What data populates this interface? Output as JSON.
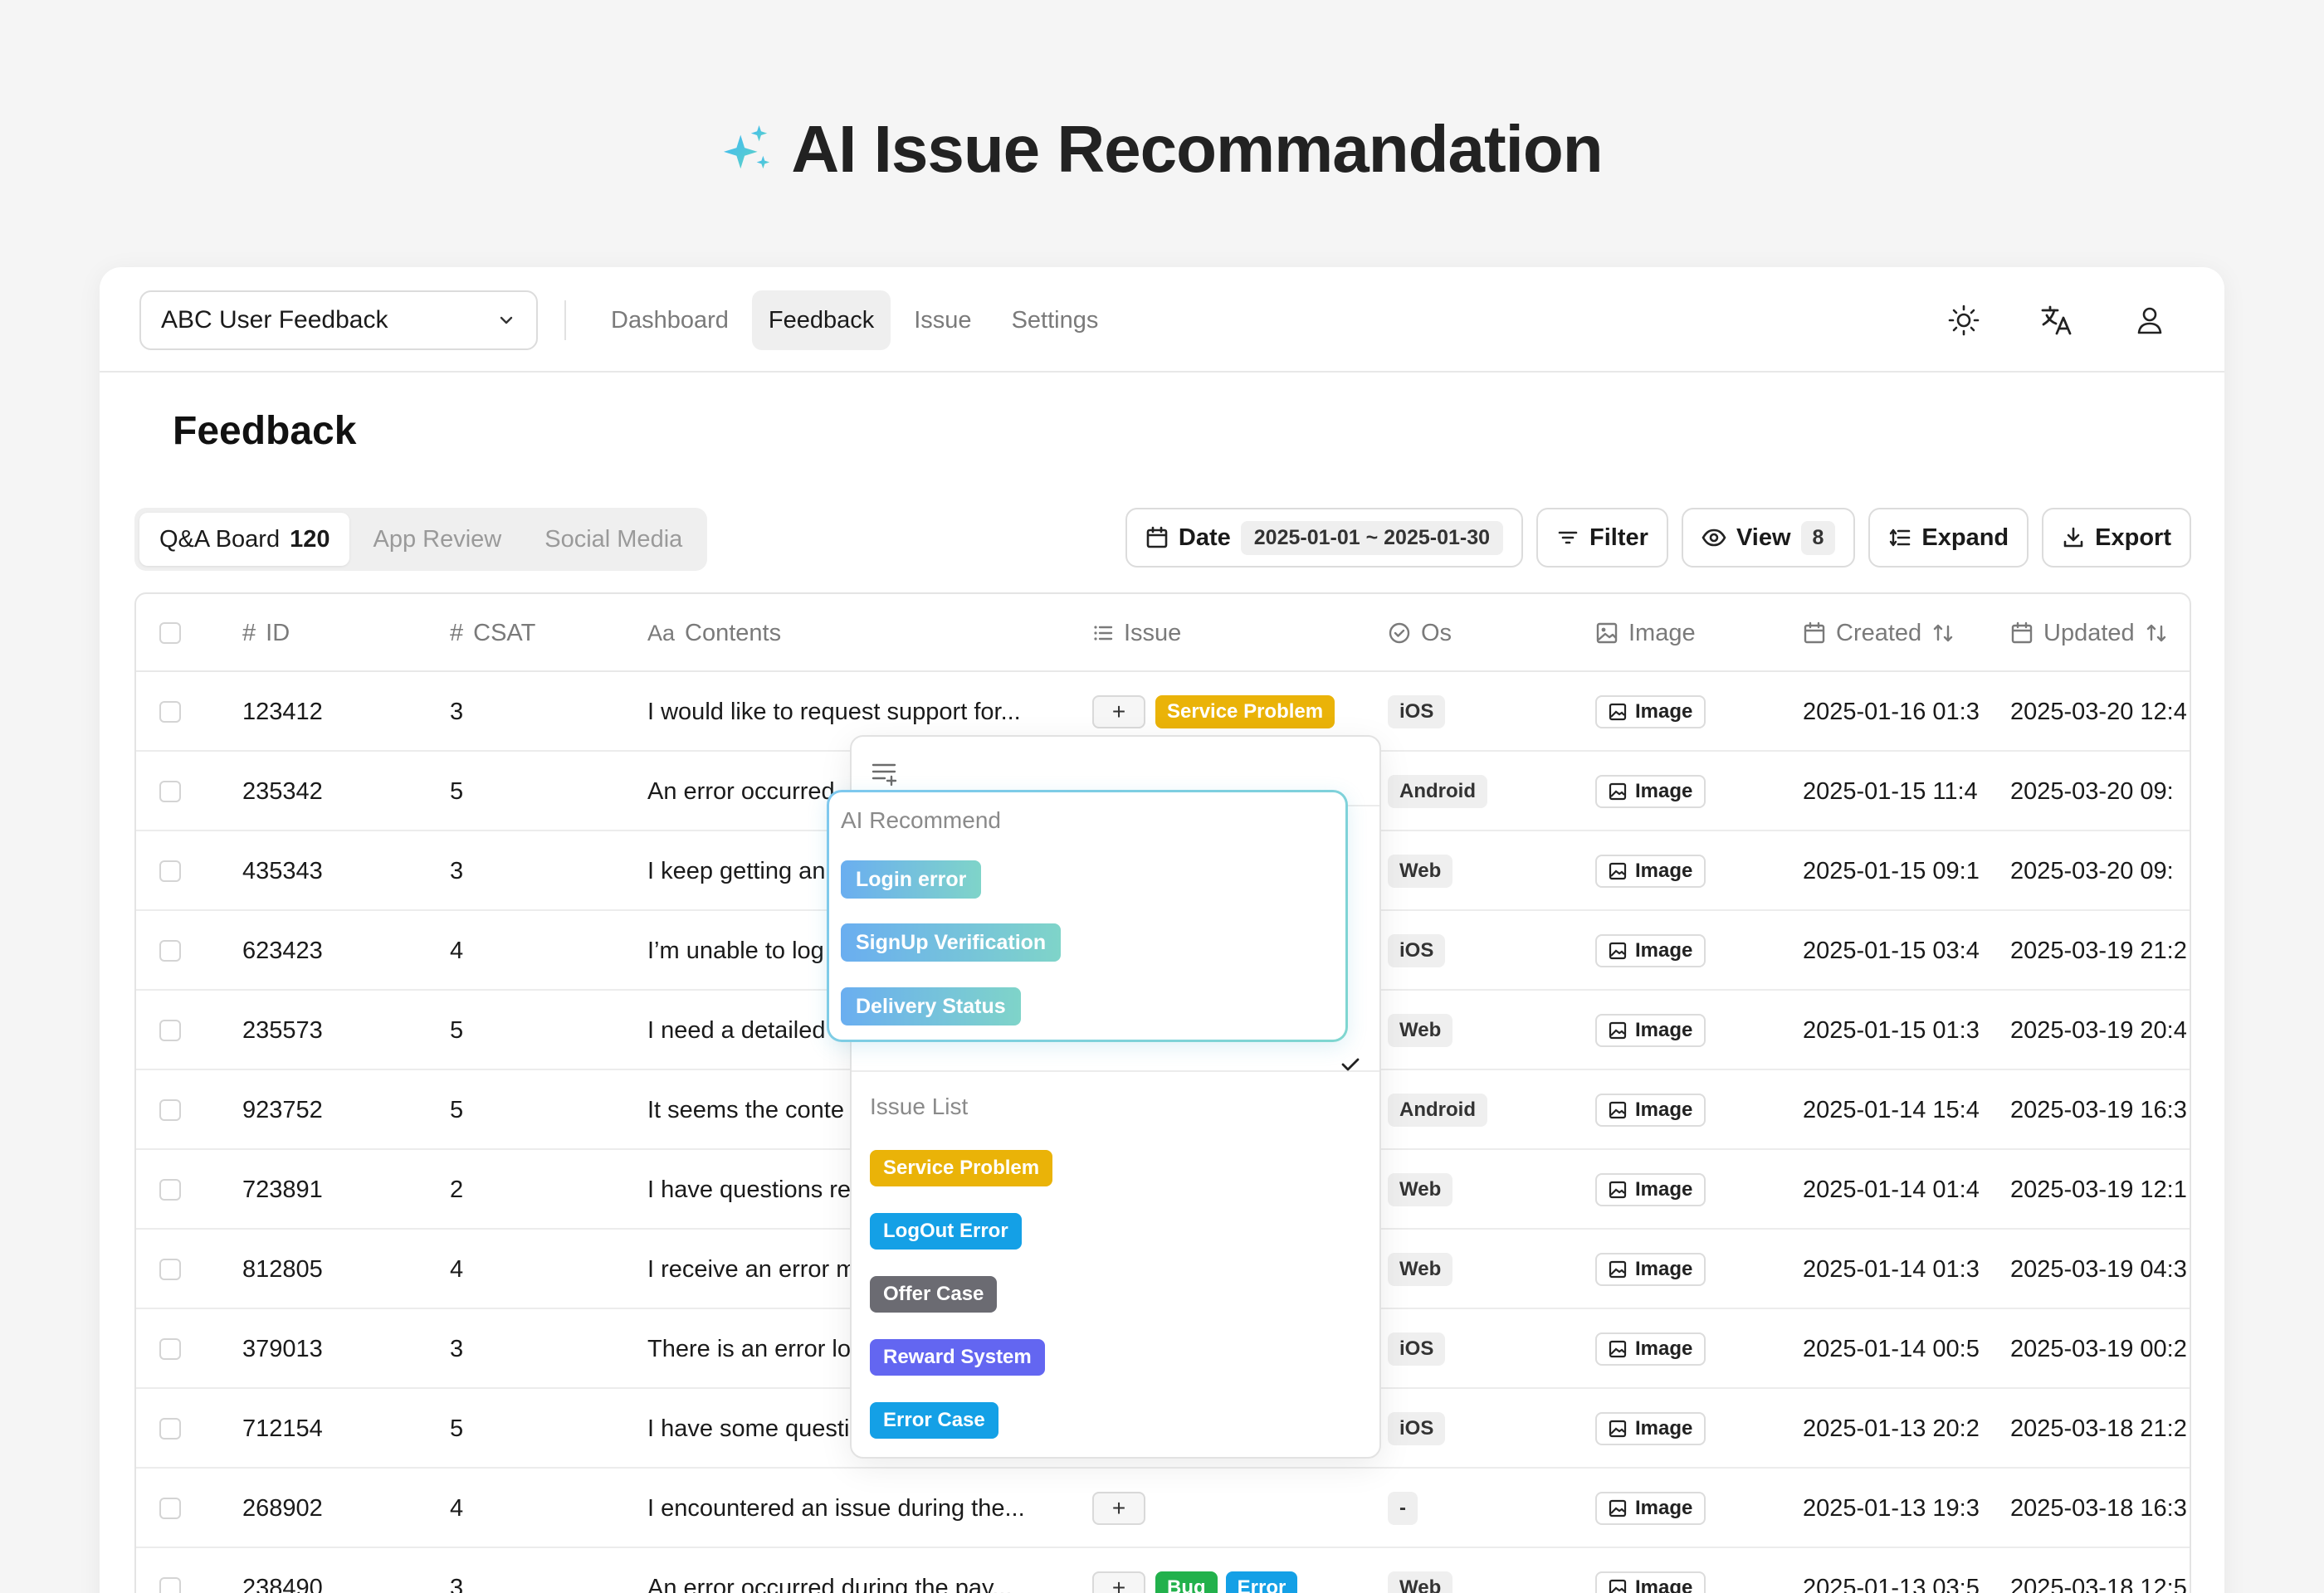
{
  "hero": {
    "title": "AI Issue Recommandation"
  },
  "header": {
    "project": "ABC User Feedback",
    "nav": [
      "Dashboard",
      "Feedback",
      "Issue",
      "Settings"
    ],
    "active_nav": "Feedback"
  },
  "page": {
    "title": "Feedback"
  },
  "channels": [
    {
      "label": "Q&A Board",
      "count": "120",
      "active": true
    },
    {
      "label": "App Review",
      "count": "",
      "active": false
    },
    {
      "label": "Social Media",
      "count": "",
      "active": false
    }
  ],
  "toolbar": {
    "date_label": "Date",
    "date_range": "2025-01-01 ~ 2025-01-30",
    "filter_label": "Filter",
    "view_label": "View",
    "view_count": "8",
    "expand_label": "Expand",
    "export_label": "Export"
  },
  "columns": {
    "id": "ID",
    "csat": "CSAT",
    "contents": "Contents",
    "issue": "Issue",
    "os": "Os",
    "image": "Image",
    "created": "Created",
    "updated": "Updated"
  },
  "rows": [
    {
      "id": "123412",
      "csat": "3",
      "contents": "I would like to request support for...",
      "issues": [
        "Service Problem"
      ],
      "os": "iOS",
      "image": "Image",
      "created": "2025-01-16 01:3",
      "updated": "2025-03-20 12:4"
    },
    {
      "id": "235342",
      "csat": "5",
      "contents": "An error occurred",
      "issues": [],
      "os": "Android",
      "image": "Image",
      "created": "2025-01-15 11:4",
      "updated": "2025-03-20 09:"
    },
    {
      "id": "435343",
      "csat": "3",
      "contents": "I keep getting an",
      "issues": [],
      "os": "Web",
      "image": "Image",
      "created": "2025-01-15 09:1",
      "updated": "2025-03-20 09:"
    },
    {
      "id": "623423",
      "csat": "4",
      "contents": "I’m unable to log",
      "issues": [],
      "os": "iOS",
      "image": "Image",
      "created": "2025-01-15 03:4",
      "updated": "2025-03-19 21:2"
    },
    {
      "id": "235573",
      "csat": "5",
      "contents": "I need a detailed",
      "issues": [],
      "os": "Web",
      "image": "Image",
      "created": "2025-01-15 01:3",
      "updated": "2025-03-19 20:4"
    },
    {
      "id": "923752",
      "csat": "5",
      "contents": "It seems the conte",
      "issues": [],
      "os": "Android",
      "image": "Image",
      "created": "2025-01-14 15:4",
      "updated": "2025-03-19 16:3"
    },
    {
      "id": "723891",
      "csat": "2",
      "contents": "I have questions re",
      "issues": [],
      "os": "Web",
      "image": "Image",
      "created": "2025-01-14 01:4",
      "updated": "2025-03-19 12:1"
    },
    {
      "id": "812805",
      "csat": "4",
      "contents": "I receive an error m",
      "issues": [],
      "os": "Web",
      "image": "Image",
      "created": "2025-01-14 01:3",
      "updated": "2025-03-19 04:3"
    },
    {
      "id": "379013",
      "csat": "3",
      "contents": "There is an error lo",
      "issues": [],
      "os": "iOS",
      "image": "Image",
      "created": "2025-01-14 00:5",
      "updated": "2025-03-19 00:2"
    },
    {
      "id": "712154",
      "csat": "5",
      "contents": "I have some questi",
      "issues": [],
      "os": "iOS",
      "image": "Image",
      "created": "2025-01-13 20:2",
      "updated": "2025-03-18 21:2"
    },
    {
      "id": "268902",
      "csat": "4",
      "contents": "I encountered an issue during the...",
      "issues": [],
      "os": "-",
      "image": "Image",
      "created": "2025-01-13 19:3",
      "updated": "2025-03-18 16:3"
    },
    {
      "id": "238490",
      "csat": "3",
      "contents": "An error occurred during the pay...",
      "issues": [
        "Bug",
        "Error"
      ],
      "os": "Web",
      "image": "Image",
      "created": "2025-01-13 03:5",
      "updated": "2025-03-18 12:5"
    }
  ],
  "issue_colors": {
    "Service Problem": "#eab308",
    "Bug": "#22b14c",
    "Error": "#14a0e6",
    "LogOut Error": "#14a0e6",
    "Offer Case": "#6b6b72",
    "Reward System": "#6366f1",
    "Error Case": "#14a0e6"
  },
  "dropdown": {
    "ai_label": "AI Recommend",
    "ai_items": [
      "Login error",
      "SignUp Verification",
      "Delivery Status"
    ],
    "list_label": "Issue List",
    "list_items": [
      "Service Problem",
      "LogOut Error",
      "Offer Case",
      "Reward System",
      "Error Case"
    ],
    "selected": "Service Problem"
  }
}
